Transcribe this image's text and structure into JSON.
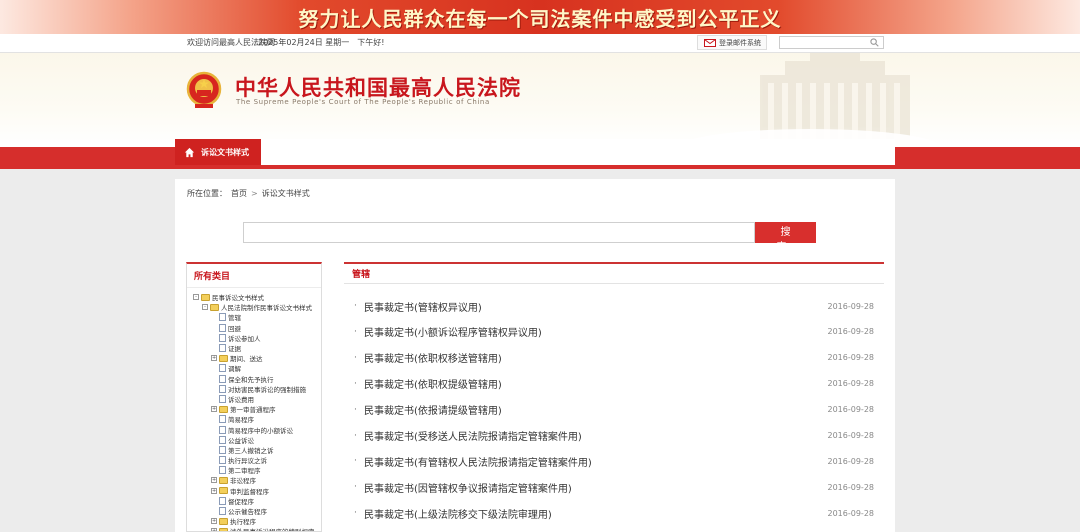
{
  "banner": {
    "slogan": "努力让人民群众在每一个司法案件中感受到公平正义"
  },
  "topbar": {
    "welcome": "欢迎访问最高人民法院网",
    "date": "2025年02月24日 星期一　下午好!",
    "email_label": "登录邮件系统",
    "search_placeholder": ""
  },
  "header": {
    "title_cn": "中华人民共和国最高人民法院",
    "title_en": "The Supreme People's Court of The People's Republic of China"
  },
  "nav": {
    "active_tab": "诉讼文书样式"
  },
  "breadcrumb": {
    "prefix": "所在位置：",
    "home": "首页",
    "current": "诉讼文书样式"
  },
  "search": {
    "value": "",
    "button_label": "搜 索"
  },
  "sidebar": {
    "title": "所有类目",
    "tree": [
      {
        "label": "民事诉讼文书样式",
        "level": 0,
        "type": "folder",
        "toggle": "-"
      },
      {
        "label": "人民法院制作民事诉讼文书样式",
        "level": 1,
        "type": "folder",
        "toggle": "-"
      },
      {
        "label": "管辖",
        "level": 2,
        "type": "doc"
      },
      {
        "label": "回避",
        "level": 2,
        "type": "doc"
      },
      {
        "label": "诉讼参加人",
        "level": 2,
        "type": "doc"
      },
      {
        "label": "证据",
        "level": 2,
        "type": "doc"
      },
      {
        "label": "期间、送达",
        "level": 2,
        "type": "folder",
        "toggle": "+"
      },
      {
        "label": "调解",
        "level": 2,
        "type": "doc"
      },
      {
        "label": "保全和先予执行",
        "level": 2,
        "type": "doc"
      },
      {
        "label": "对妨害民事诉讼的强制措施",
        "level": 2,
        "type": "doc"
      },
      {
        "label": "诉讼费用",
        "level": 2,
        "type": "doc"
      },
      {
        "label": "第一审普通程序",
        "level": 2,
        "type": "folder",
        "toggle": "+"
      },
      {
        "label": "简易程序",
        "level": 2,
        "type": "doc"
      },
      {
        "label": "简易程序中的小额诉讼",
        "level": 2,
        "type": "doc"
      },
      {
        "label": "公益诉讼",
        "level": 2,
        "type": "doc"
      },
      {
        "label": "第三人撤销之诉",
        "level": 2,
        "type": "doc"
      },
      {
        "label": "执行异议之诉",
        "level": 2,
        "type": "doc"
      },
      {
        "label": "第二审程序",
        "level": 2,
        "type": "doc"
      },
      {
        "label": "非讼程序",
        "level": 2,
        "type": "folder",
        "toggle": "+"
      },
      {
        "label": "审判监督程序",
        "level": 2,
        "type": "folder",
        "toggle": "+"
      },
      {
        "label": "督促程序",
        "level": 2,
        "type": "doc"
      },
      {
        "label": "公示催告程序",
        "level": 2,
        "type": "doc"
      },
      {
        "label": "执行程序",
        "level": 2,
        "type": "folder",
        "toggle": "+"
      },
      {
        "label": "涉外民事诉讼程序的特别规定",
        "level": 2,
        "type": "folder",
        "toggle": "+"
      }
    ]
  },
  "main": {
    "section_title": "管辖",
    "items": [
      {
        "title": "民事裁定书(管辖权异议用)",
        "date": "2016-09-28"
      },
      {
        "title": "民事裁定书(小额诉讼程序管辖权异议用)",
        "date": "2016-09-28"
      },
      {
        "title": "民事裁定书(依职权移送管辖用)",
        "date": "2016-09-28"
      },
      {
        "title": "民事裁定书(依职权提级管辖用)",
        "date": "2016-09-28"
      },
      {
        "title": "民事裁定书(依报请提级管辖用)",
        "date": "2016-09-28"
      },
      {
        "title": "民事裁定书(受移送人民法院报请指定管辖案件用)",
        "date": "2016-09-28"
      },
      {
        "title": "民事裁定书(有管辖权人民法院报请指定管辖案件用)",
        "date": "2016-09-28"
      },
      {
        "title": "民事裁定书(因管辖权争议报请指定管辖案件用)",
        "date": "2016-09-28"
      },
      {
        "title": "民事裁定书(上级法院移交下级法院审理用)",
        "date": "2016-09-28"
      }
    ]
  },
  "colors": {
    "brand_red": "#c8161d",
    "nav_red": "#d62e2c",
    "button_red": "#d82f2d"
  },
  "icons": {
    "home": "home-icon",
    "email": "envelope-icon",
    "search": "search-icon",
    "emblem": "national-emblem-icon"
  }
}
